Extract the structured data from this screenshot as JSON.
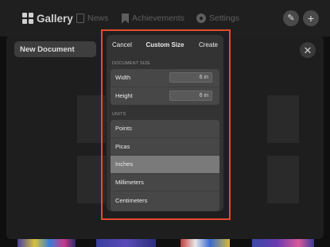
{
  "nav": {
    "gallery": "Gallery",
    "news": "News",
    "achievements": "Achievements",
    "settings": "Settings",
    "edit_icon": "pencil-icon",
    "add_icon": "plus-icon"
  },
  "backdrop": {
    "new_document_label": "New Document",
    "close_icon": "close-icon"
  },
  "dialog": {
    "cancel": "Cancel",
    "title": "Custom Size",
    "create": "Create",
    "document_size_label": "DOCUMENT SIZE",
    "width_label": "Width",
    "width_value": "6 in",
    "height_label": "Height",
    "height_value": "6 in",
    "units_label": "UNITS",
    "units": [
      "Points",
      "Picas",
      "Inches",
      "Millimeters",
      "Centimeters"
    ],
    "selected_unit": "Inches"
  },
  "colors": {
    "highlight": "#e64a2e",
    "selected_row": "#7a7a7a",
    "dialog_bg": "#333333"
  }
}
